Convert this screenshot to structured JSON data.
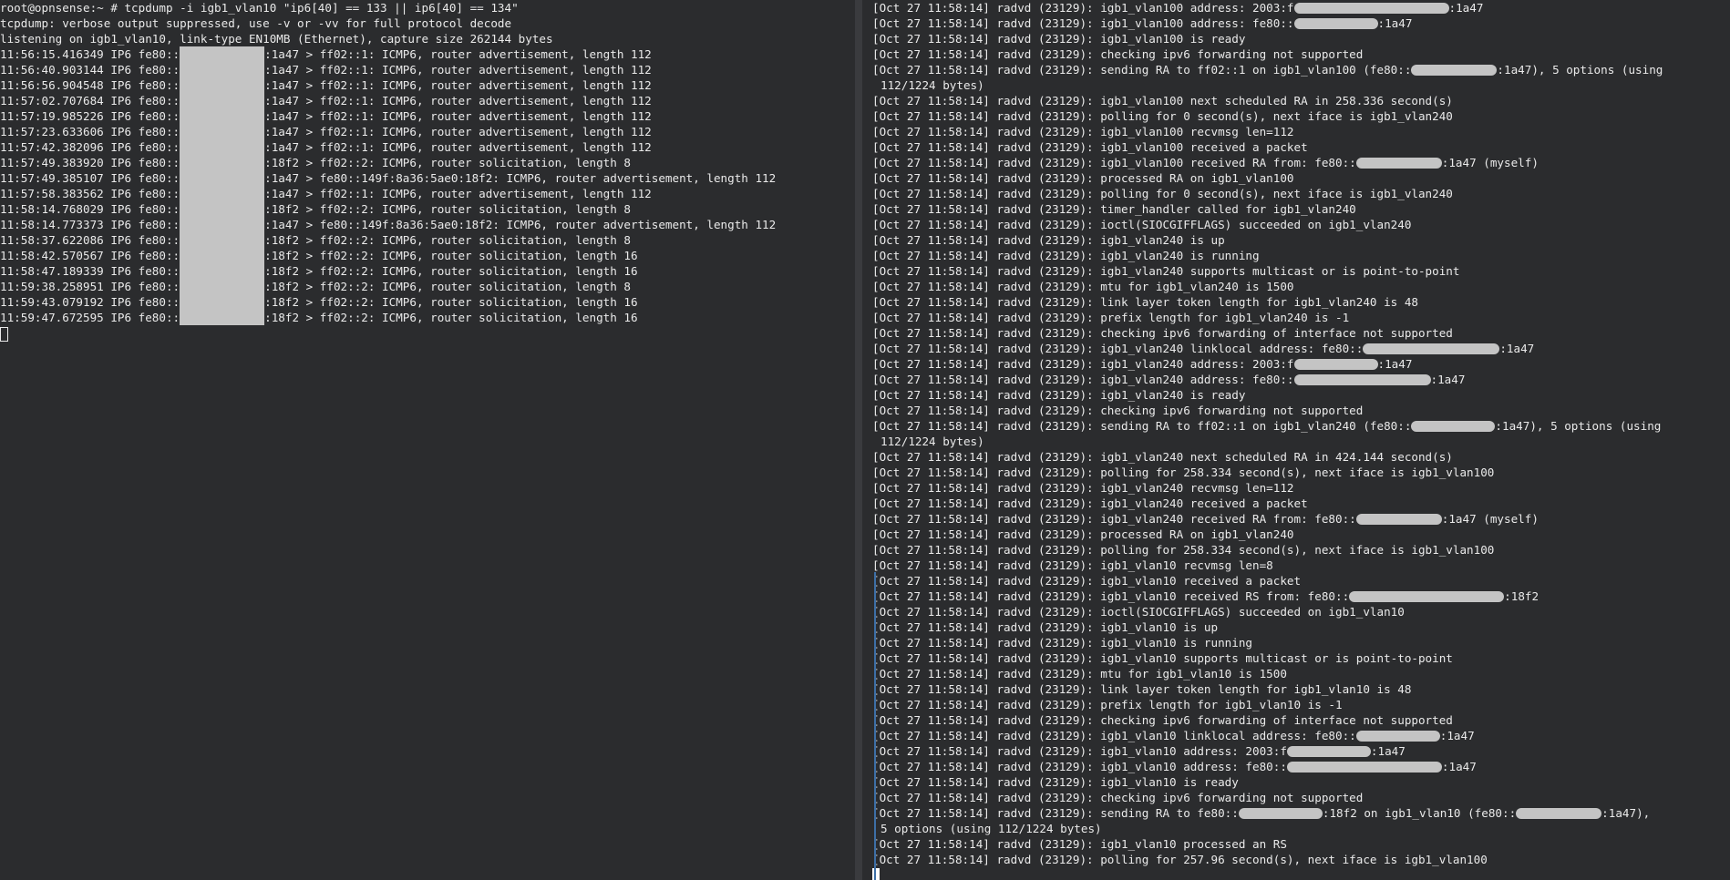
{
  "left_pane": {
    "command": "root@opnsense:~ # tcpdump -i igb1_vlan10 \"ip6[40] == 133 || ip6[40] == 134\"",
    "info1": "tcpdump: verbose output suppressed, use -v or -vv for full protocol decode",
    "info2": "listening on igb1_vlan10, link-type EN10MB (Ethernet), capture size 262144 bytes",
    "packets": [
      {
        "time": "11:56:15.416349",
        "suffix": ":1a47 > ff02::1: ICMP6, router advertisement, length 112"
      },
      {
        "time": "11:56:40.903144",
        "suffix": ":1a47 > ff02::1: ICMP6, router advertisement, length 112"
      },
      {
        "time": "11:56:56.904548",
        "suffix": ":1a47 > ff02::1: ICMP6, router advertisement, length 112"
      },
      {
        "time": "11:57:02.707684",
        "suffix": ":1a47 > ff02::1: ICMP6, router advertisement, length 112"
      },
      {
        "time": "11:57:19.985226",
        "suffix": ":1a47 > ff02::1: ICMP6, router advertisement, length 112"
      },
      {
        "time": "11:57:23.633606",
        "suffix": ":1a47 > ff02::1: ICMP6, router advertisement, length 112"
      },
      {
        "time": "11:57:42.382096",
        "suffix": ":1a47 > ff02::1: ICMP6, router advertisement, length 112"
      },
      {
        "time": "11:57:49.383920",
        "suffix": ":18f2 > ff02::2: ICMP6, router solicitation, length 8"
      },
      {
        "time": "11:57:49.385107",
        "suffix": ":1a47 > fe80::149f:8a36:5ae0:18f2: ICMP6, router advertisement, length 112"
      },
      {
        "time": "11:57:58.383562",
        "suffix": ":1a47 > ff02::1: ICMP6, router advertisement, length 112"
      },
      {
        "time": "11:58:14.768029",
        "suffix": ":18f2 > ff02::2: ICMP6, router solicitation, length 8"
      },
      {
        "time": "11:58:14.773373",
        "suffix": ":1a47 > fe80::149f:8a36:5ae0:18f2: ICMP6, router advertisement, length 112"
      },
      {
        "time": "11:58:37.622086",
        "suffix": ":18f2 > ff02::2: ICMP6, router solicitation, length 8"
      },
      {
        "time": "11:58:42.570567",
        "suffix": ":18f2 > ff02::2: ICMP6, router solicitation, length 16"
      },
      {
        "time": "11:58:47.189339",
        "suffix": ":18f2 > ff02::2: ICMP6, router solicitation, length 16"
      },
      {
        "time": "11:59:38.258951",
        "suffix": ":18f2 > ff02::2: ICMP6, router solicitation, length 8"
      },
      {
        "time": "11:59:43.079192",
        "suffix": ":18f2 > ff02::2: ICMP6, router solicitation, length 16"
      },
      {
        "time": "11:59:47.672595",
        "suffix": ":18f2 > ff02::2: ICMP6, router solicitation, length 16"
      }
    ],
    "packet_proto": " IP6 fe80::"
  },
  "right_pane": {
    "prefix": "[Oct 27 11:58:14] radvd (23129): ",
    "lines": [
      {
        "a": "igb1_vlan100 address: 2003:f",
        "b": ":1a47"
      },
      {
        "a": "igb1_vlan100 address: fe80::",
        "b": ":1a47"
      },
      {
        "a": "igb1_vlan100 is ready"
      },
      {
        "a": "checking ipv6 forwarding not supported"
      },
      {
        "a": "sending RA to ff02::1 on igb1_vlan100 (fe80::",
        "b": ":1a47), 5 options (using"
      },
      {
        "cont": "112/1224 bytes)"
      },
      {
        "a": "igb1_vlan100 next scheduled RA in 258.336 second(s)"
      },
      {
        "a": "polling for 0 second(s), next iface is igb1_vlan240"
      },
      {
        "a": "igb1_vlan100 recvmsg len=112"
      },
      {
        "a": "igb1_vlan100 received a packet"
      },
      {
        "a": "igb1_vlan100 received RA from: fe80::",
        "b": ":1a47 (myself)"
      },
      {
        "a": "processed RA on igb1_vlan100"
      },
      {
        "a": "polling for 0 second(s), next iface is igb1_vlan240"
      },
      {
        "a": "timer_handler called for igb1_vlan240"
      },
      {
        "a": "ioctl(SIOCGIFFLAGS) succeeded on igb1_vlan240"
      },
      {
        "a": "igb1_vlan240 is up"
      },
      {
        "a": "igb1_vlan240 is running"
      },
      {
        "a": "igb1_vlan240 supports multicast or is point-to-point"
      },
      {
        "a": "mtu for igb1_vlan240 is 1500"
      },
      {
        "a": "link layer token length for igb1_vlan240 is 48"
      },
      {
        "a": "prefix length for igb1_vlan240 is -1"
      },
      {
        "a": "checking ipv6 forwarding of interface not supported"
      },
      {
        "a": "igb1_vlan240 linklocal address: fe80::",
        "b": ":1a47"
      },
      {
        "a": "igb1_vlan240 address: 2003:f",
        "b": ":1a47"
      },
      {
        "a": "igb1_vlan240 address: fe80::",
        "b": ":1a47"
      },
      {
        "a": "igb1_vlan240 is ready"
      },
      {
        "a": "checking ipv6 forwarding not supported"
      },
      {
        "a": "sending RA to ff02::1 on igb1_vlan240 (fe80::",
        "b": ":1a47), 5 options (using"
      },
      {
        "cont": "112/1224 bytes)"
      },
      {
        "a": "igb1_vlan240 next scheduled RA in 424.144 second(s)"
      },
      {
        "a": "polling for 258.334 second(s), next iface is igb1_vlan100"
      },
      {
        "a": "igb1_vlan240 recvmsg len=112"
      },
      {
        "a": "igb1_vlan240 received a packet"
      },
      {
        "a": "igb1_vlan240 received RA from: fe80::",
        "b": ":1a47 (myself)"
      },
      {
        "a": "processed RA on igb1_vlan240"
      },
      {
        "a": "polling for 258.334 second(s), next iface is igb1_vlan100"
      },
      {
        "a": "igb1_vlan10 recvmsg len=8"
      },
      {
        "a": "igb1_vlan10 received a packet"
      },
      {
        "a": "igb1_vlan10 received RS from: fe80::",
        "b": ":18f2"
      },
      {
        "a": "ioctl(SIOCGIFFLAGS) succeeded on igb1_vlan10"
      },
      {
        "a": "igb1_vlan10 is up"
      },
      {
        "a": "igb1_vlan10 is running"
      },
      {
        "a": "igb1_vlan10 supports multicast or is point-to-point"
      },
      {
        "a": "mtu for igb1_vlan10 is 1500"
      },
      {
        "a": "link layer token length for igb1_vlan10 is 48"
      },
      {
        "a": "prefix length for igb1_vlan10 is -1"
      },
      {
        "a": "checking ipv6 forwarding of interface not supported"
      },
      {
        "a": "igb1_vlan10 linklocal address: fe80::",
        "b": ":1a47"
      },
      {
        "a": "igb1_vlan10 address: 2003:f",
        "b": ":1a47"
      },
      {
        "a": "igb1_vlan10 address: fe80::",
        "b": ":1a47"
      },
      {
        "a": "igb1_vlan10 is ready"
      },
      {
        "a": "checking ipv6 forwarding not supported"
      },
      {
        "a": "sending RA to fe80::",
        "b": ":18f2 on igb1_vlan10 (fe80::",
        "c": ":1a47),"
      },
      {
        "cont": "5 options (using 112/1224 bytes)"
      },
      {
        "a": "igb1_vlan10 processed an RS"
      },
      {
        "a": "polling for 257.96 second(s), next iface is igb1_vlan100"
      }
    ]
  },
  "colors": {
    "background": "#2b2c2e",
    "text": "#eaeaea",
    "redaction": "#c4c4c4",
    "active_indicator": "#3d6fa6"
  }
}
